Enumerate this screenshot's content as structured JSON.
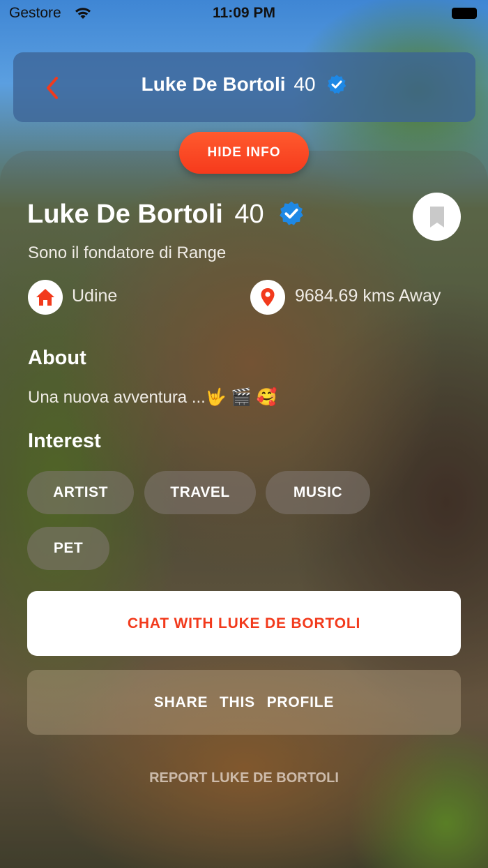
{
  "status_bar": {
    "carrier": "Gestore",
    "time": "11:09 PM",
    "icons": [
      "wifi-icon",
      "battery-icon"
    ]
  },
  "header": {
    "name": "Luke De Bortoli",
    "age": "40",
    "icons": [
      "back-chevron-icon",
      "verified-badge-icon"
    ]
  },
  "hide_info_label": "HIDE INFO",
  "profile": {
    "name": "Luke De Bortoli",
    "age": "40",
    "bio": "Sono il fondatore di Range",
    "city": "Udine",
    "distance": "9684.69 kms Away"
  },
  "about": {
    "title": "About",
    "text": "Una nuova avventura ...🤟 🎬 🥰"
  },
  "interest": {
    "title": "Interest",
    "chips": [
      "ARTIST",
      "TRAVEL",
      "MUSIC",
      "PET"
    ]
  },
  "actions": {
    "chat_label": "CHAT WITH LUKE DE BORTOLI",
    "share_label": "SHARE THIS PROFILE",
    "report_label": "REPORT LUKE DE BORTOLI"
  },
  "colors": {
    "accent": "#f63a1c",
    "verified": "#1e88e5",
    "header_bg": "#3c6496"
  }
}
